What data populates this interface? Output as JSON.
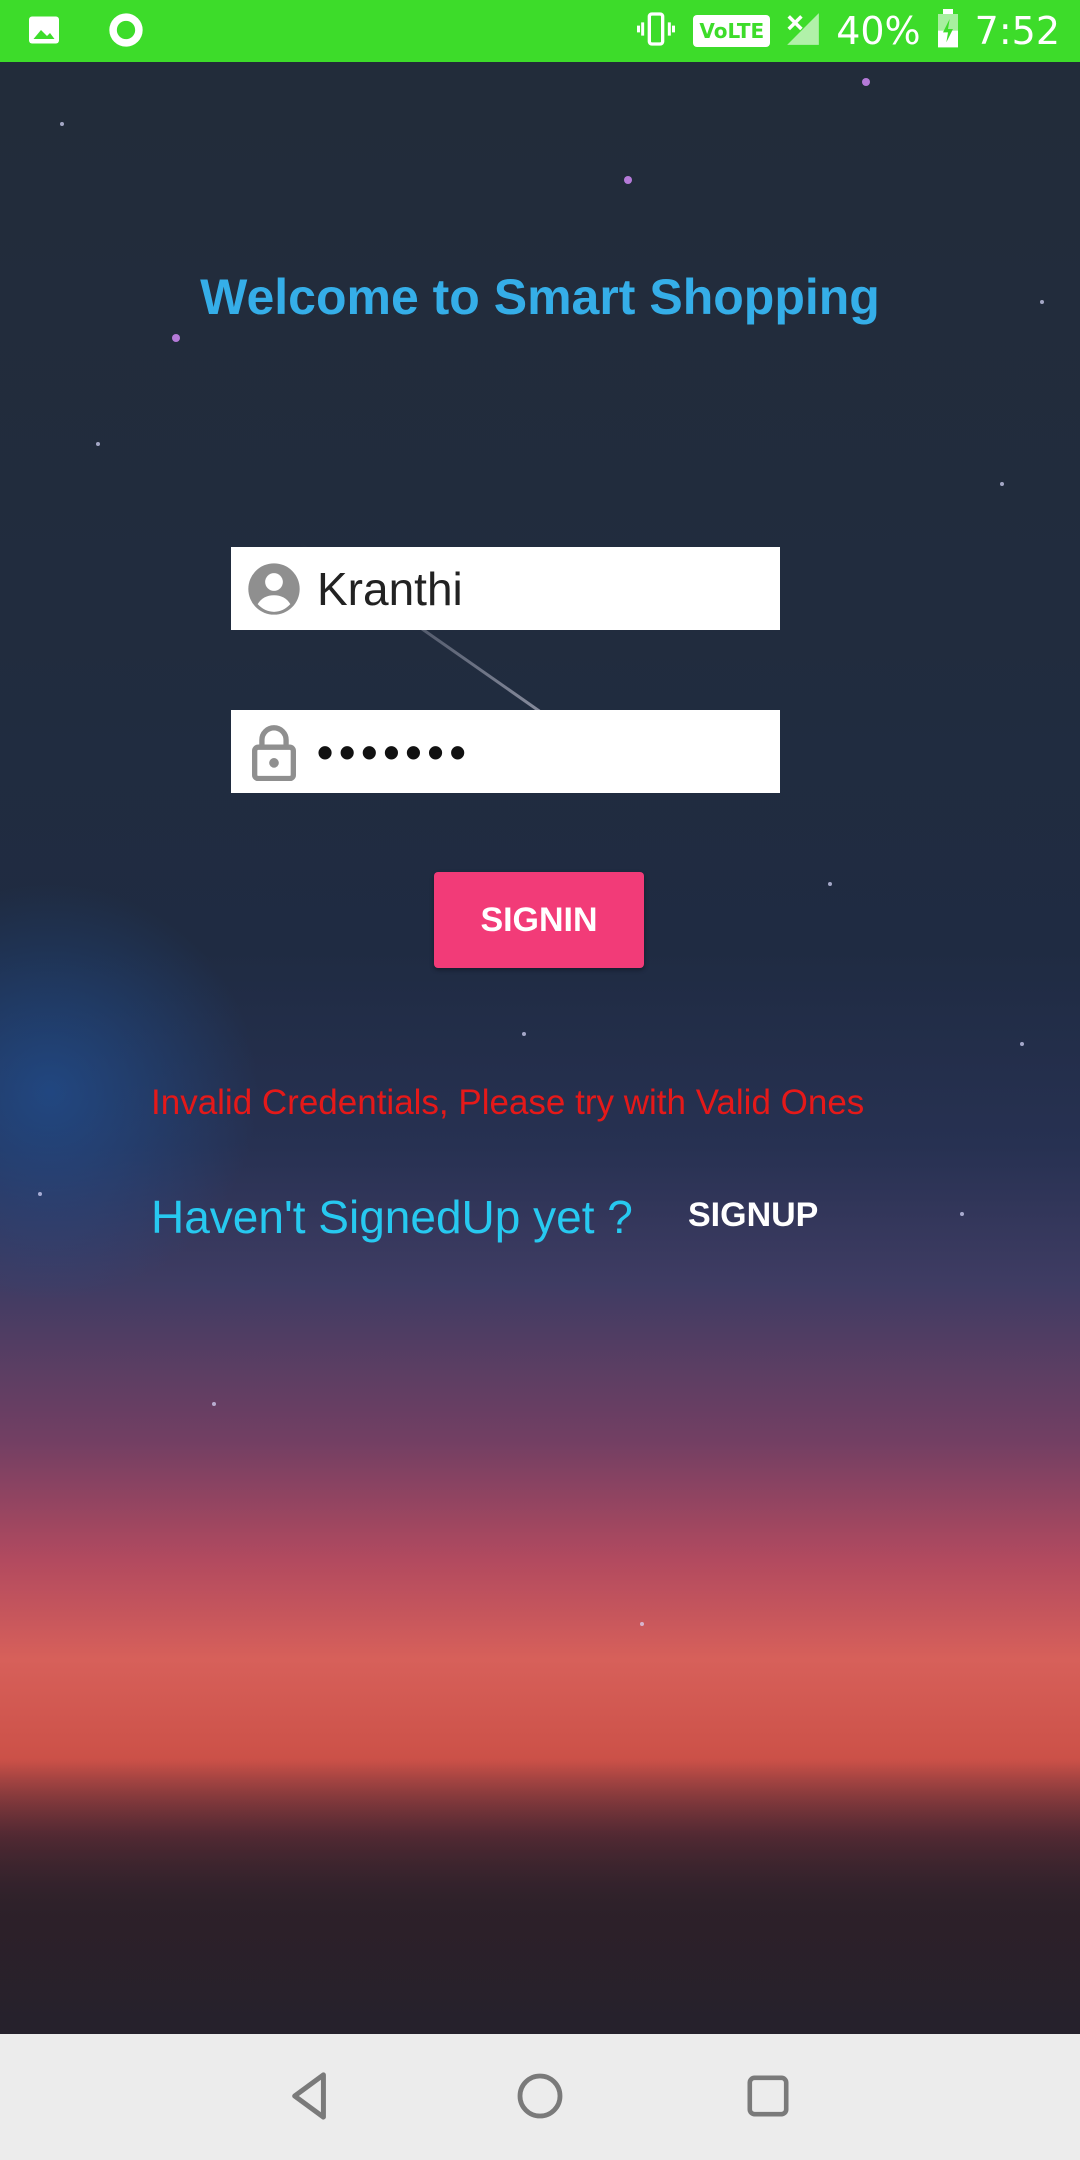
{
  "status_bar": {
    "battery_percent": "40%",
    "time": "7:52",
    "network_label": "VoLTE",
    "icons": [
      "image-notification-icon",
      "circle-notification-icon",
      "vibrate-icon",
      "volte-icon",
      "signal-icon",
      "battery-charging-icon"
    ]
  },
  "login": {
    "title": "Welcome to Smart Shopping",
    "username_value": "Kranthi",
    "password_masked": "•••••••",
    "signin_label": "SIGNIN",
    "error_message": "Invalid Credentials, Please try with Valid Ones",
    "signup_prompt": "Haven't SignedUp yet ?",
    "signup_label": "SIGNUP"
  },
  "nav_bar": {
    "icons": [
      "back-icon",
      "home-icon",
      "recents-icon"
    ]
  },
  "colors": {
    "status_bar": "#3ddc2a",
    "title": "#35aee8",
    "signin_button": "#f23b78",
    "error": "#e51919",
    "prompt": "#27c9f0"
  }
}
